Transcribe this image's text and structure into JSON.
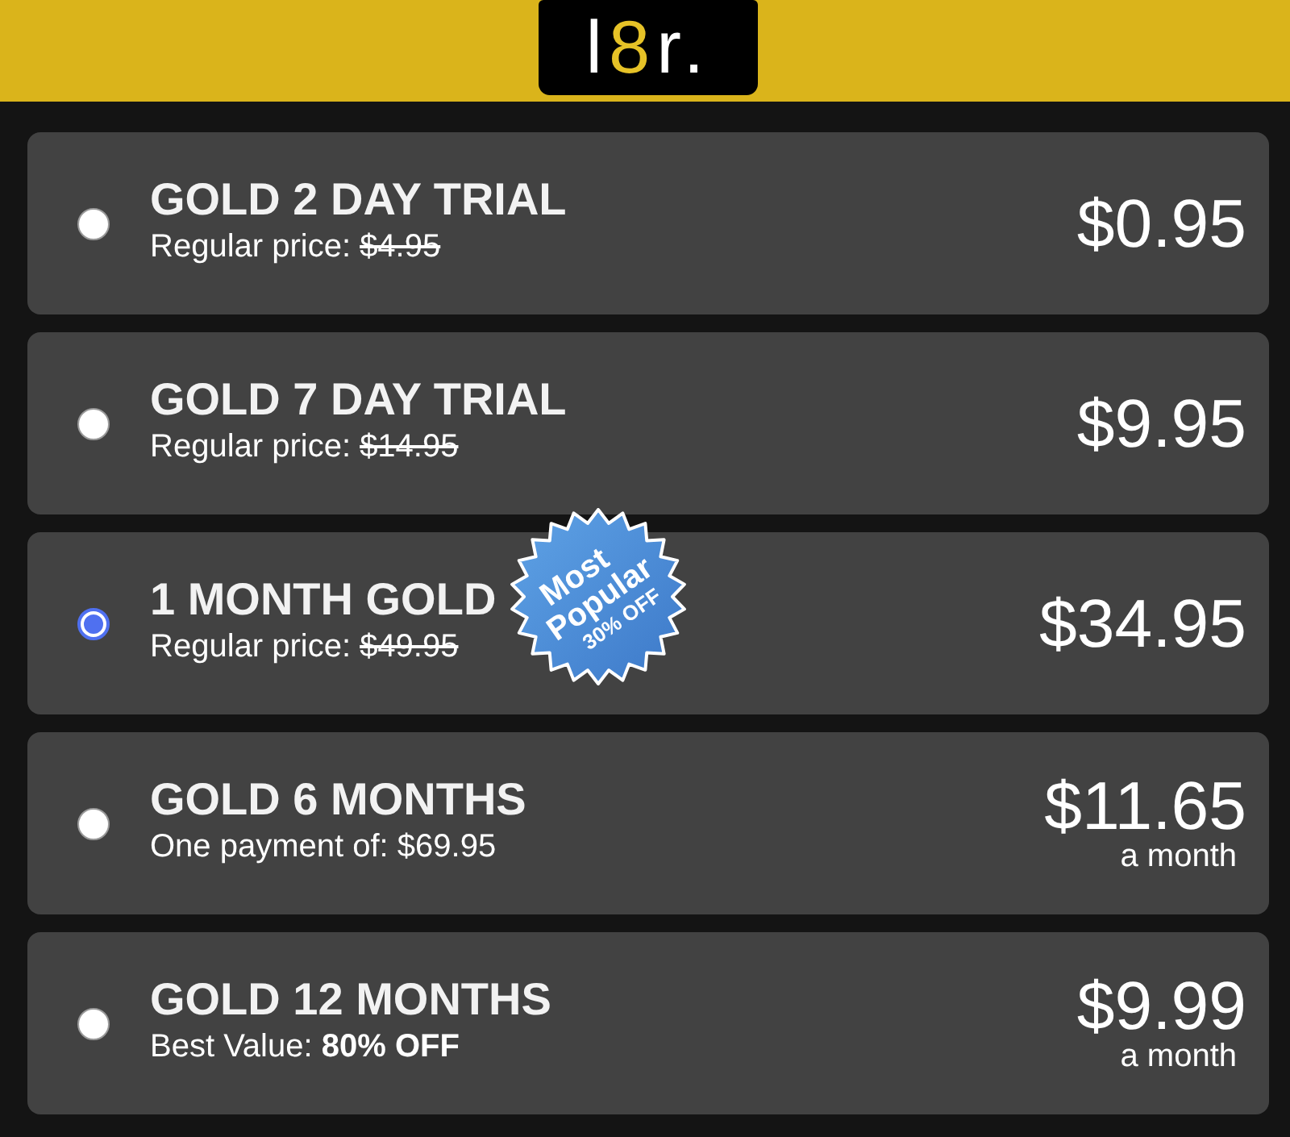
{
  "logo": {
    "parts": [
      {
        "text": "l",
        "color": "#ffffff"
      },
      {
        "text": "8",
        "color": "#e6c227"
      },
      {
        "text": "r.",
        "color": "#ffffff"
      }
    ]
  },
  "plans": [
    {
      "title": "GOLD 2 DAY TRIAL",
      "selected": false,
      "note": {
        "kind": "was",
        "label": "Regular price:",
        "value": "$4.95"
      },
      "price": "$0.95"
    },
    {
      "title": "GOLD 7 DAY TRIAL",
      "selected": false,
      "note": {
        "kind": "was",
        "label": "Regular price:",
        "value": "$14.95"
      },
      "price": "$9.95"
    },
    {
      "title": "1 MONTH GOLD",
      "selected": true,
      "note": {
        "kind": "was",
        "label": "Regular price:",
        "value": "$49.95"
      },
      "price": "$34.95",
      "badge": {
        "lines": [
          "Most",
          "Popular",
          "30% OFF"
        ]
      }
    },
    {
      "title": "GOLD 6 MONTHS",
      "selected": false,
      "note": {
        "kind": "text",
        "text": "One payment of: $69.95"
      },
      "price": "$11.65",
      "period": "a month"
    },
    {
      "title": "GOLD 12 MONTHS",
      "selected": false,
      "note": {
        "kind": "text",
        "text": "Best Value: **80% OFF**"
      },
      "price": "$9.99",
      "period": "a month"
    }
  ]
}
